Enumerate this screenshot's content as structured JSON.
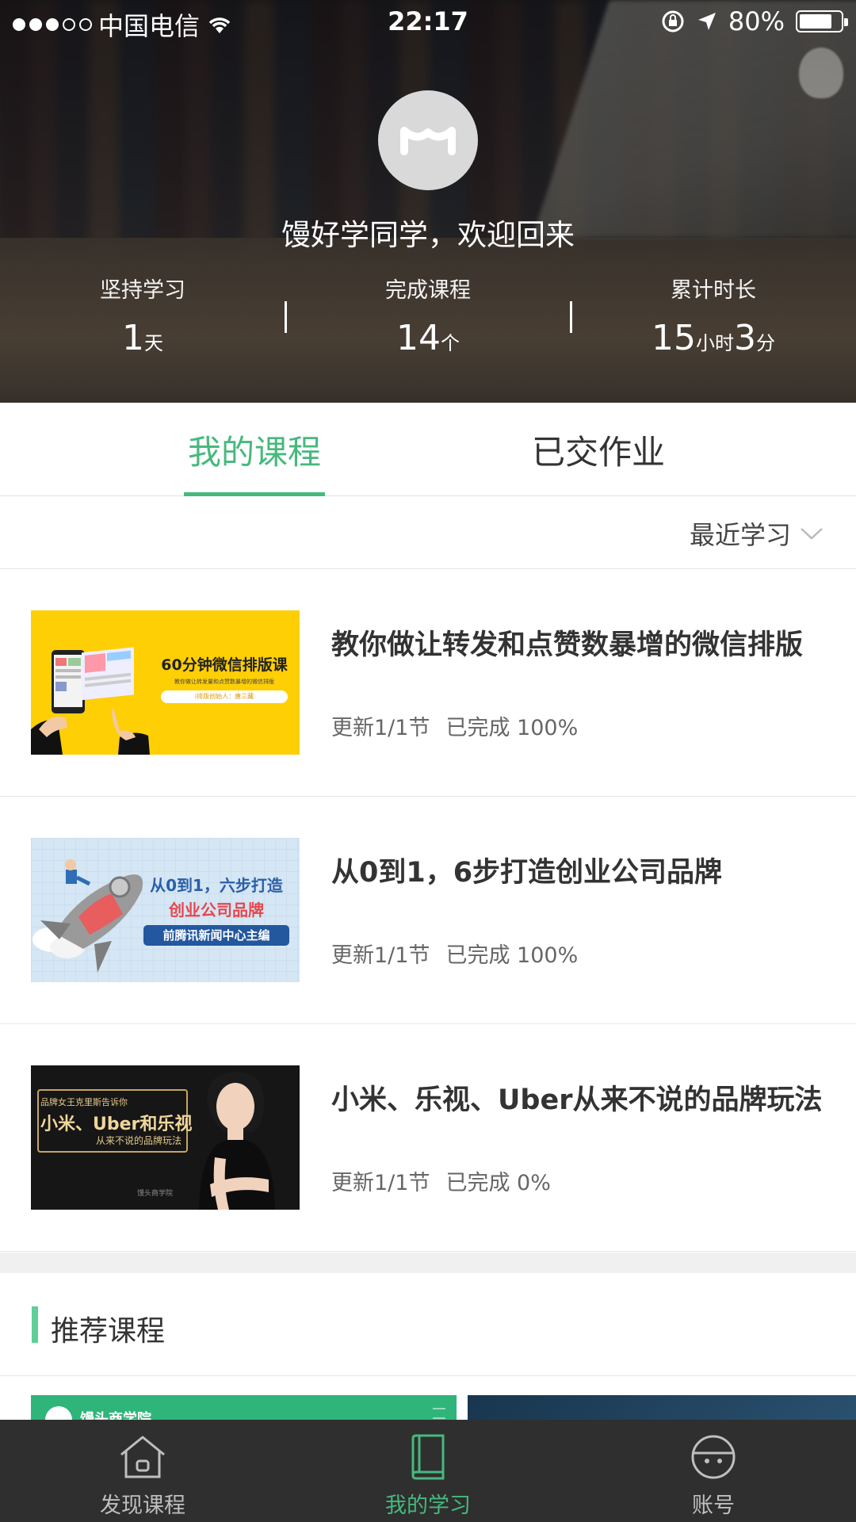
{
  "status_bar": {
    "carrier": "中国电信",
    "time": "22:17",
    "battery": "80%",
    "battery_level": 0.8,
    "signal_dots_filled": 3,
    "signal_dots_total": 5
  },
  "profile": {
    "welcome": "馒好学同学，欢迎回来",
    "stats": [
      {
        "label": "坚持学习",
        "value": "1",
        "unit": "天"
      },
      {
        "label": "完成课程",
        "value": "14",
        "unit": "个"
      },
      {
        "label": "累计时长",
        "value_hours": "15",
        "unit_hours": "小时",
        "value_minutes": "3",
        "unit_minutes": "分"
      }
    ]
  },
  "tabs": [
    {
      "label": "我的课程",
      "active": true
    },
    {
      "label": "已交作业",
      "active": false
    }
  ],
  "sort": {
    "label": "最近学习"
  },
  "courses": [
    {
      "title": "教你做让转发和点赞数暴增的微信排版",
      "update": "更新1/1节",
      "progress": "已完成 100%",
      "thumb": {
        "headline": "60分钟微信排版课",
        "sub": "教你做让转发量和点赞数暴增的微信排版",
        "tag": "i排版创始人：唐三藏"
      }
    },
    {
      "title": "从0到1，6步打造创业公司品牌",
      "update": "更新1/1节",
      "progress": "已完成 100%",
      "thumb": {
        "line1": "从0到1，六步打造",
        "line2": "创业公司品牌",
        "tag": "前腾讯新闻中心主编"
      }
    },
    {
      "title": "小米、乐视、Uber从来不说的品牌玩法",
      "update": "更新1/1节",
      "progress": "已完成 0%",
      "thumb": {
        "top": "品牌女王克里斯告诉你",
        "main": "小米、Uber和乐视",
        "sub": "从来不说的品牌玩法",
        "logo": "馒头商学院"
      }
    }
  ],
  "recommend": {
    "title": "推荐课程",
    "card1_label": "馒头商学院"
  },
  "nav": [
    {
      "label": "发现课程",
      "icon": "home-icon",
      "active": false
    },
    {
      "label": "我的学习",
      "icon": "book-icon",
      "active": true
    },
    {
      "label": "账号",
      "icon": "account-icon",
      "active": false
    }
  ],
  "colors": {
    "accent": "#46b97d",
    "nav_bg": "#2f2f2f",
    "recommend_bar": "#5fcf97"
  }
}
